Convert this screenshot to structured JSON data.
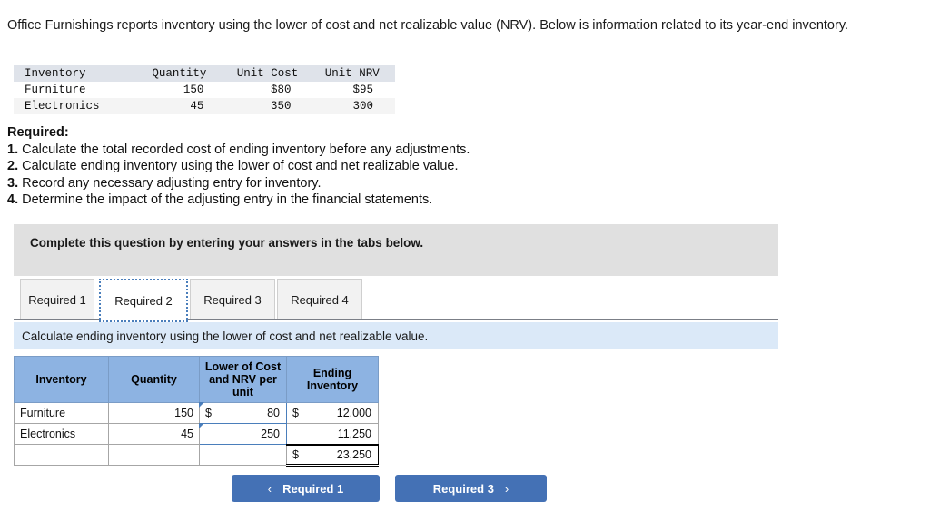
{
  "intro": {
    "text": "Office Furnishings reports inventory using the lower of cost and net realizable value (NRV). Below is information related to its year-end inventory."
  },
  "given_table": {
    "headers": [
      "Inventory",
      "Quantity",
      "Unit Cost",
      "Unit NRV"
    ],
    "rows": [
      {
        "inventory": "Furniture",
        "quantity": "150",
        "unit_cost": "$80",
        "unit_nrv": "$95"
      },
      {
        "inventory": "Electronics",
        "quantity": "45",
        "unit_cost": "350",
        "unit_nrv": "300"
      }
    ]
  },
  "required": {
    "heading": "Required:",
    "items": [
      {
        "num": "1.",
        "text": " Calculate the total recorded cost of ending inventory before any adjustments."
      },
      {
        "num": "2.",
        "text": " Calculate ending inventory using the lower of cost and net realizable value."
      },
      {
        "num": "3.",
        "text": " Record any necessary adjusting entry for inventory."
      },
      {
        "num": "4.",
        "text": " Determine the impact of the adjusting entry in the financial statements."
      }
    ]
  },
  "gray_panel": {
    "text": "Complete this question by entering your answers in the tabs below."
  },
  "tabs": [
    {
      "label": "Required 1",
      "active": false
    },
    {
      "label": "Required 2",
      "active": true
    },
    {
      "label": "Required 3",
      "active": false
    },
    {
      "label": "Required 4",
      "active": false
    }
  ],
  "blue_bar": {
    "text": "Calculate ending inventory using the lower of cost and net realizable value."
  },
  "answer_grid": {
    "headers": [
      "Inventory",
      "Quantity",
      "Lower of Cost and NRV per unit",
      "Ending Inventory"
    ],
    "rows": [
      {
        "inventory": "Furniture",
        "quantity": "150",
        "lower_currency": "$",
        "lower_value": "80",
        "ending_currency": "$",
        "ending_value": "12,000"
      },
      {
        "inventory": "Electronics",
        "quantity": "45",
        "lower_currency": "",
        "lower_value": "250",
        "ending_currency": "",
        "ending_value": "11,250"
      }
    ],
    "total_row": {
      "inventory": "",
      "quantity": "",
      "lower_value": "",
      "ending_currency": "$",
      "ending_value": "23,250"
    }
  },
  "nav": {
    "prev_label": "Required 1",
    "prev_chevron": "‹",
    "next_label": "Required 3",
    "next_chevron": "›"
  },
  "colors": {
    "header_blue": "#8db3e2",
    "bar_blue": "#dbe9f8",
    "panel_gray": "#e0e0e0",
    "button_blue": "#4471b5",
    "focus_blue": "#4a7ebb"
  }
}
